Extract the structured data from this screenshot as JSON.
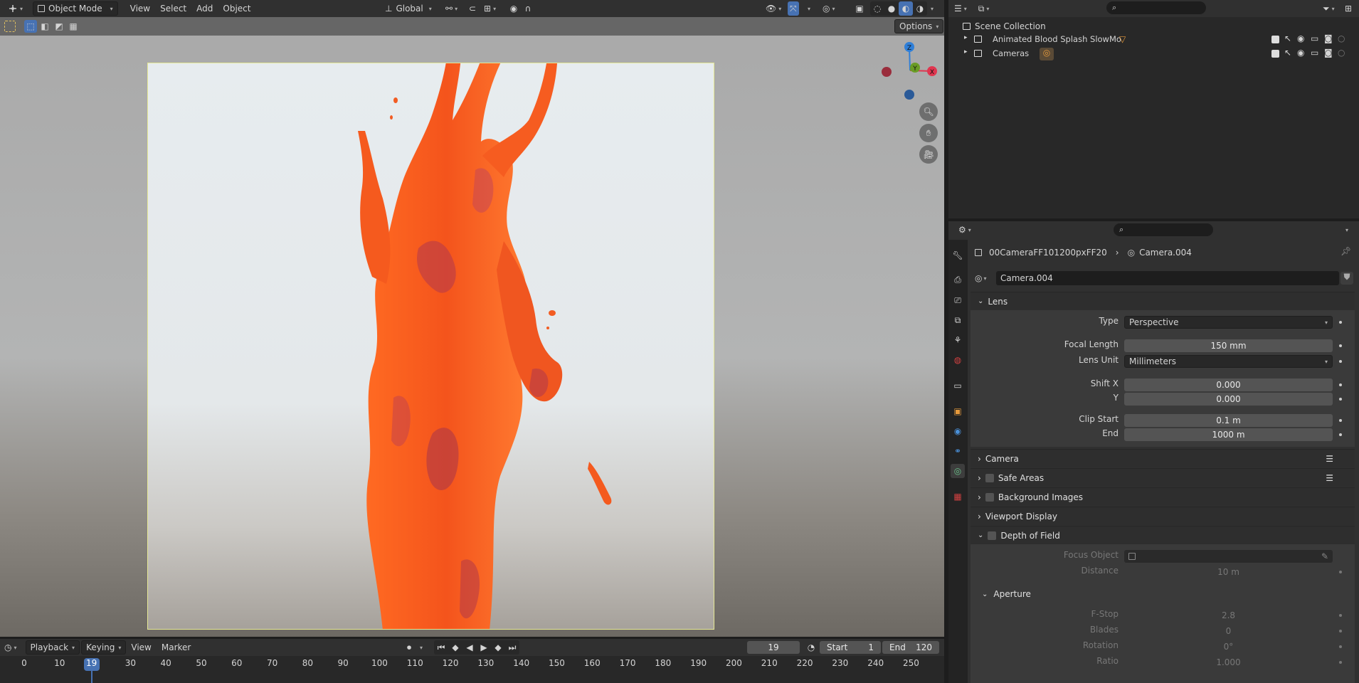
{
  "viewport_header": {
    "mode": "Object Mode",
    "menus": [
      "View",
      "Select",
      "Add",
      "Object"
    ],
    "orientation": "Global",
    "options": "Options"
  },
  "viewport": {
    "gizmo_labels": {
      "z": "Z",
      "x": "X",
      "y": "Y"
    }
  },
  "timeline": {
    "menus": {
      "playback": "Playback",
      "keying": "Keying",
      "view": "View",
      "marker": "Marker"
    },
    "current_frame": "19",
    "start_label": "Start",
    "start_value": "1",
    "end_label": "End",
    "end_value": "120",
    "ticks": [
      "0",
      "10",
      "19",
      "30",
      "40",
      "50",
      "60",
      "70",
      "80",
      "90",
      "100",
      "110",
      "120",
      "130",
      "140",
      "150",
      "160",
      "170",
      "180",
      "190",
      "200",
      "210",
      "220",
      "230",
      "240",
      "250"
    ]
  },
  "outliner": {
    "root": "Scene Collection",
    "items": [
      {
        "label": "Animated Blood Splash SlowMo"
      },
      {
        "label": "Cameras"
      }
    ]
  },
  "properties": {
    "breadcrumb_object": "00CameraFF101200pxFF20",
    "breadcrumb_data": "Camera.004",
    "datablock_name": "Camera.004",
    "lens_panel": "Lens",
    "type_label": "Type",
    "type_value": "Perspective",
    "focal_label": "Focal Length",
    "focal_value": "150 mm",
    "lens_unit_label": "Lens Unit",
    "lens_unit_value": "Millimeters",
    "shift_x_label": "Shift X",
    "shift_x_value": "0.000",
    "shift_y_label": "Y",
    "shift_y_value": "0.000",
    "clip_start_label": "Clip Start",
    "clip_start_value": "0.1 m",
    "clip_end_label": "End",
    "clip_end_value": "1000 m",
    "camera_panel": "Camera",
    "safe_areas_panel": "Safe Areas",
    "background_images_panel": "Background Images",
    "viewport_display_panel": "Viewport Display",
    "dof_panel": "Depth of Field",
    "focus_object_label": "Focus Object",
    "distance_label": "Distance",
    "distance_value": "10 m",
    "aperture_panel": "Aperture",
    "fstop_label": "F-Stop",
    "fstop_value": "2.8",
    "blades_label": "Blades",
    "blades_value": "0",
    "rotation_label": "Rotation",
    "rotation_value": "0°",
    "ratio_label": "Ratio",
    "ratio_value": "1.000"
  },
  "colors": {
    "accent": "#4772b3",
    "active_frame": "#4772b3",
    "camera_frame": "#e5e896",
    "splash": "#ff5a1c",
    "gizmo_x": "#e0354f",
    "gizmo_y": "#6a9c25",
    "gizmo_z": "#2f7fd8"
  }
}
